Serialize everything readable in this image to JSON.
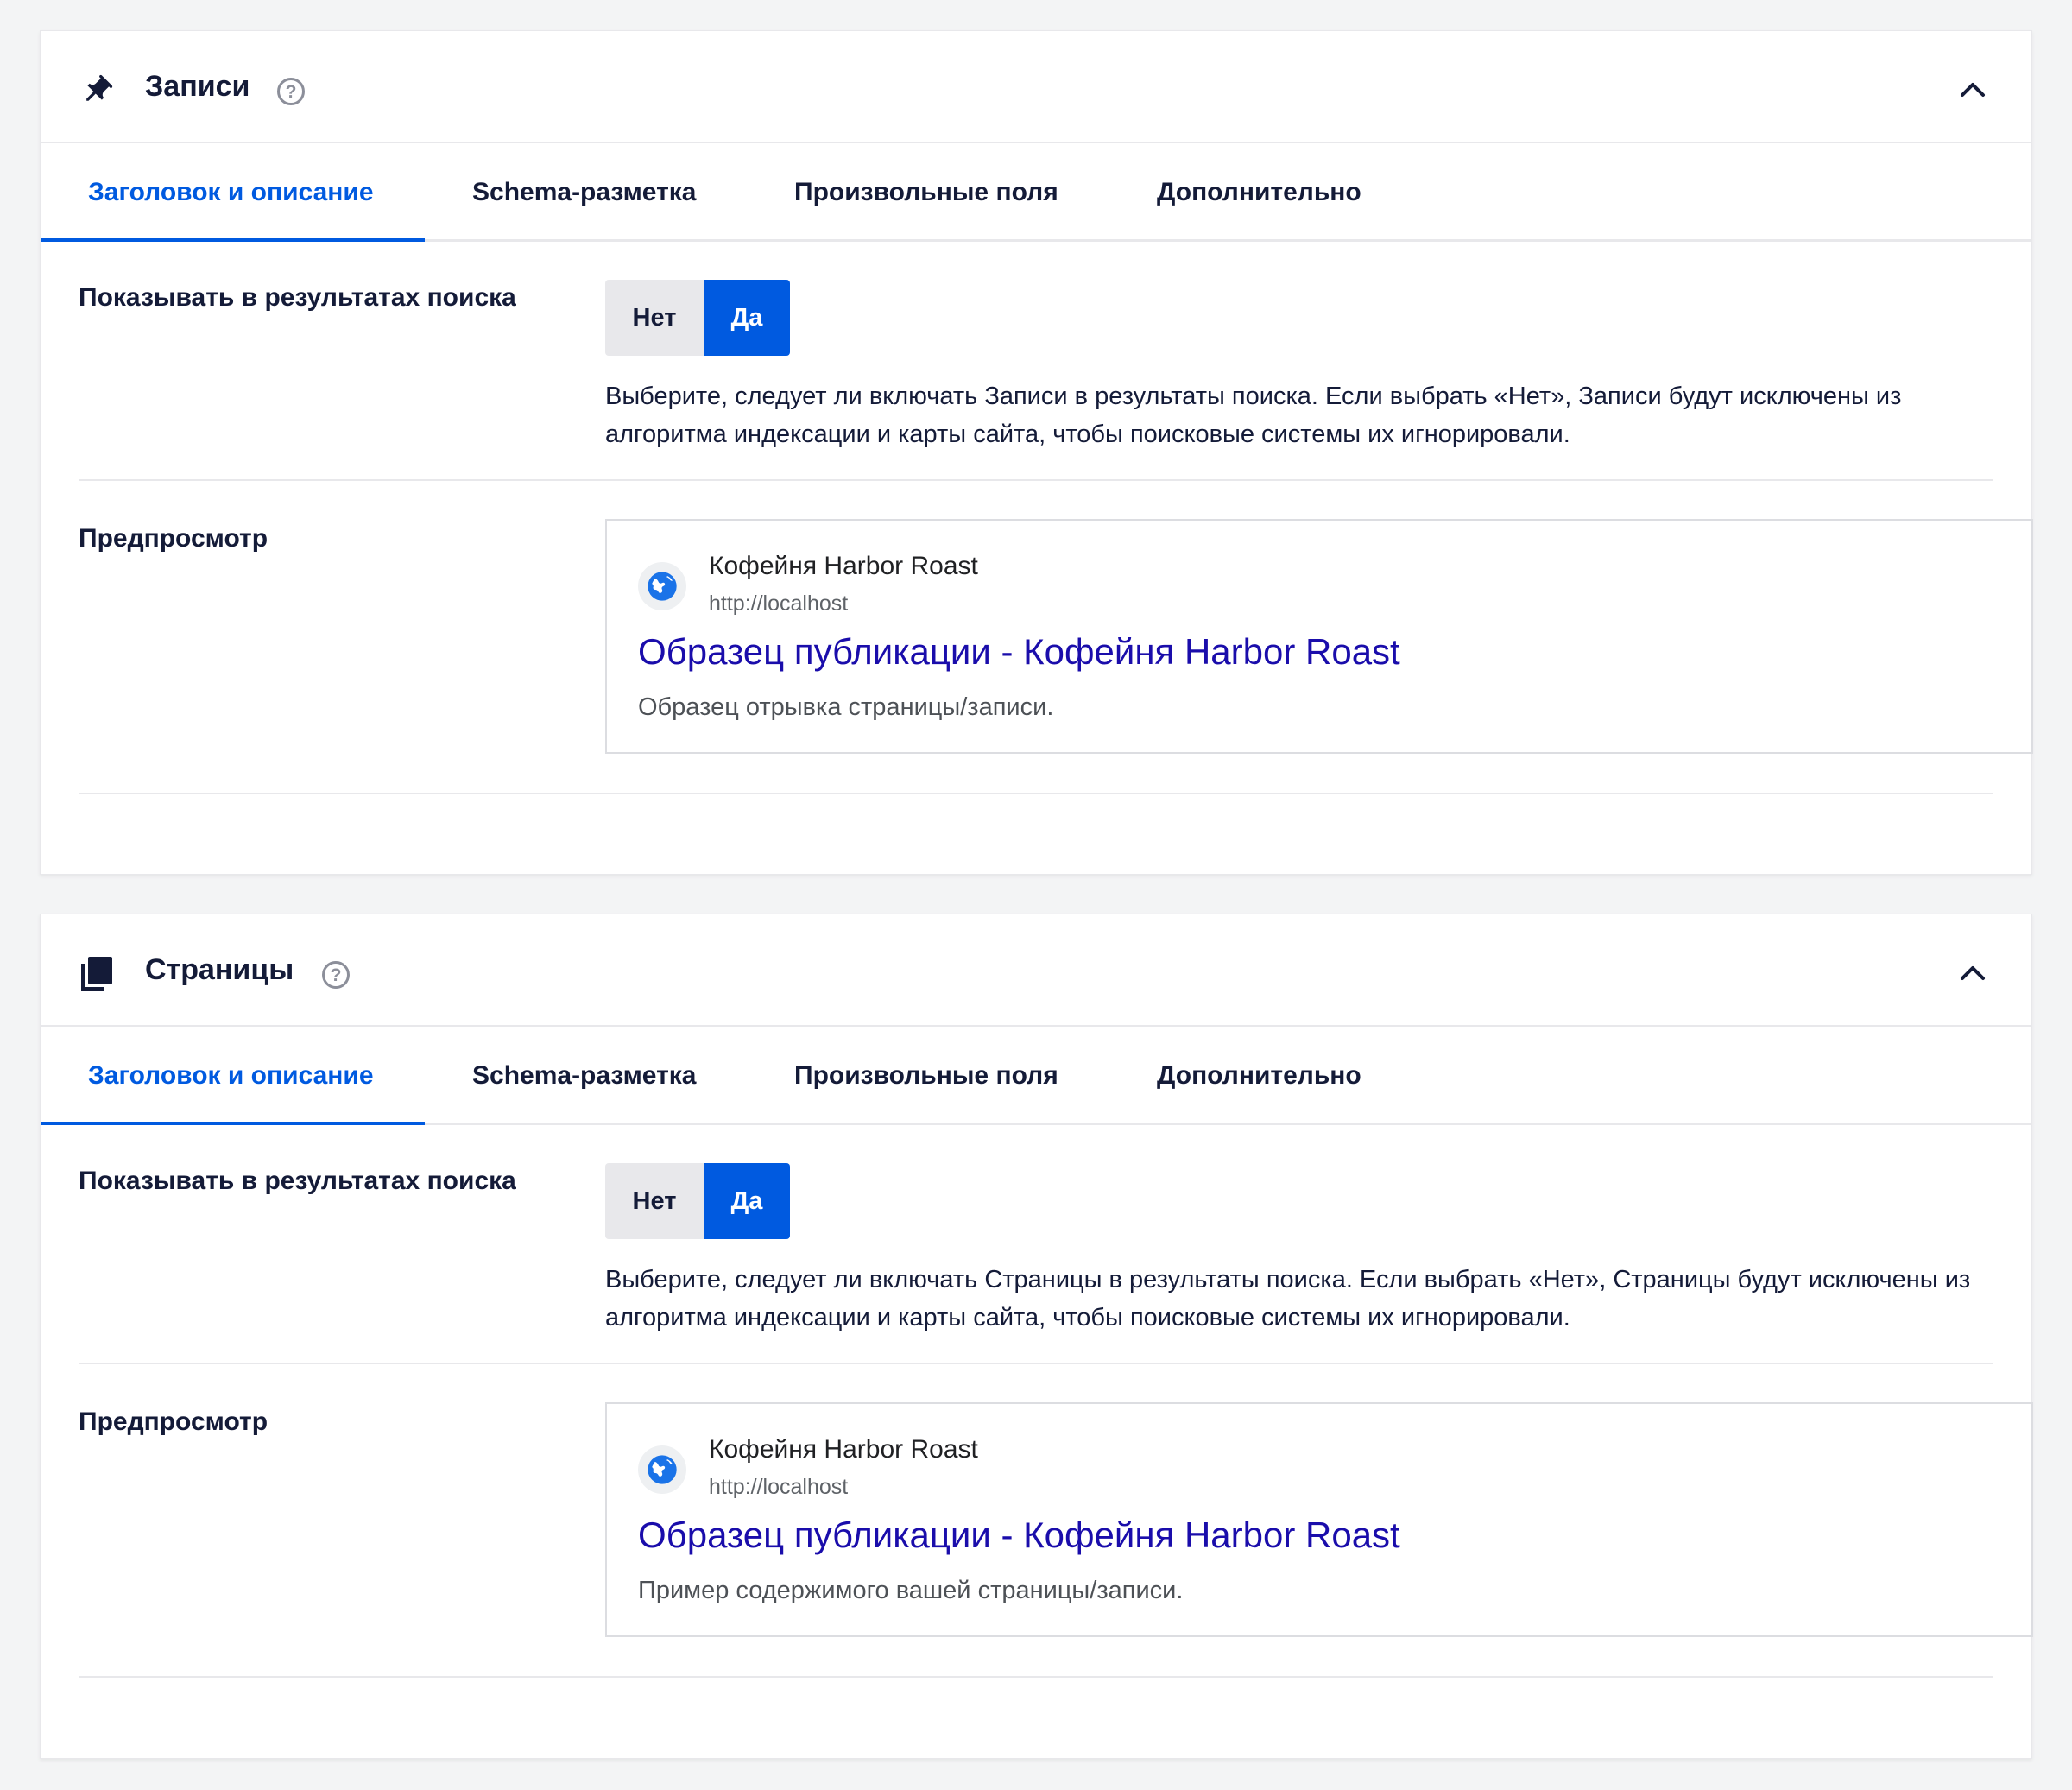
{
  "sections": [
    {
      "title": "Записи",
      "icon": "pin-icon",
      "help": "?",
      "tabs": [
        "Заголовок и описание",
        "Schema-разметка",
        "Произвольные поля",
        "Дополнительно"
      ],
      "active_tab": "Заголовок и описание",
      "show_label": "Показывать в результатах поиска",
      "toggle": {
        "no": "Нет",
        "yes": "Да",
        "selected": "Да"
      },
      "description": "Выберите, следует ли включать Записи в результаты поиска. Если выбрать «Нет», Записи будут исключены из алгоритма индексации и карты сайта, чтобы поисковые системы их игнорировали.",
      "preview_label": "Предпросмотр",
      "preview": {
        "site_name": "Кофейня Harbor Roast",
        "url": "http://localhost",
        "title": "Образец публикации - Кофейня Harbor Roast",
        "snippet": "Образец отрывка страницы/записи."
      }
    },
    {
      "title": "Страницы",
      "icon": "pages-icon",
      "help": "?",
      "tabs": [
        "Заголовок и описание",
        "Schema-разметка",
        "Произвольные поля",
        "Дополнительно"
      ],
      "active_tab": "Заголовок и описание",
      "show_label": "Показывать в результатах поиска",
      "toggle": {
        "no": "Нет",
        "yes": "Да",
        "selected": "Да"
      },
      "description": "Выберите, следует ли включать Страницы в результаты поиска. Если выбрать «Нет», Страницы будут исключены из алгоритма индексации и карты сайта, чтобы поисковые системы их игнорировали.",
      "preview_label": "Предпросмотр",
      "preview": {
        "site_name": "Кофейня Harbor Roast",
        "url": "http://localhost",
        "title": "Образец публикации - Кофейня Harbor Roast",
        "snippet": "Пример содержимого вашей страницы/записи."
      }
    }
  ],
  "colors": {
    "accent": "#005ae0",
    "text": "#141b38",
    "serp_title": "#1a0dab",
    "background": "#f3f4f5"
  }
}
